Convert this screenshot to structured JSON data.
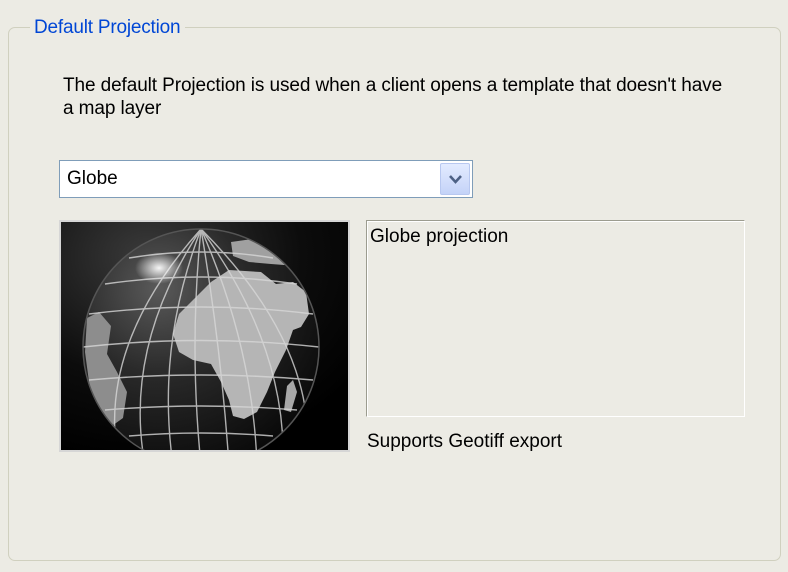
{
  "group": {
    "title": "Default Projection"
  },
  "description": "The default Projection is used when a client opens a template that doesn't have a map layer",
  "projection_select": {
    "value": "Globe"
  },
  "preview": {
    "image_icon": "globe-icon"
  },
  "projection_info": {
    "name": "Globe projection",
    "support_text": "Supports Geotiff export"
  }
}
